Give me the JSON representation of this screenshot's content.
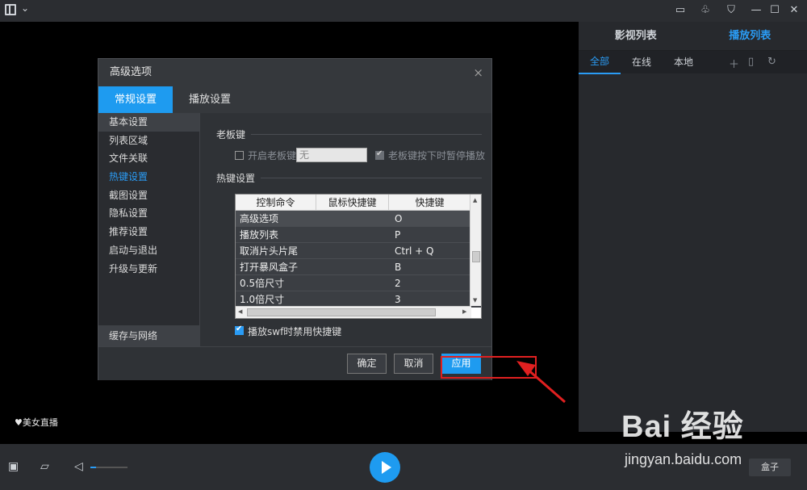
{
  "app": {
    "menu_chevron": "⌄",
    "top_icons": [
      "comment-icon",
      "bell-icon",
      "shirt-icon",
      "minimize-icon",
      "maximize-icon",
      "close-icon"
    ]
  },
  "right_panel": {
    "tabs": [
      {
        "label": "影视列表"
      },
      {
        "label": "播放列表"
      }
    ],
    "subtabs": [
      {
        "label": "全部"
      },
      {
        "label": "在线"
      },
      {
        "label": "本地"
      }
    ],
    "icons": [
      "add-icon",
      "add-file-icon",
      "refresh-icon"
    ]
  },
  "live_label": "美女直播",
  "bottom": {
    "box_label": "盒子",
    "volume_level": 0.15
  },
  "watermark": {
    "brand": "Bai 经验",
    "url": "jingyan.baidu.com"
  },
  "dialog": {
    "title": "高级选项",
    "close": "×",
    "tabs": [
      {
        "label": "常规设置"
      },
      {
        "label": "播放设置"
      }
    ],
    "sidebar": [
      {
        "label": "基本设置"
      },
      {
        "label": "列表区域"
      },
      {
        "label": "文件关联"
      },
      {
        "label": "热键设置"
      },
      {
        "label": "截图设置"
      },
      {
        "label": "隐私设置"
      },
      {
        "label": "推荐设置"
      },
      {
        "label": "启动与退出"
      },
      {
        "label": "升级与更新"
      }
    ],
    "sidebar_bottom": "缓存与网络",
    "boss_key": {
      "section": "老板键",
      "enable_label": "开启老板键",
      "key_value": "无",
      "pause_label": "老板键按下时暂停播放"
    },
    "hotkeys": {
      "section": "热键设置",
      "columns": [
        "控制命令",
        "鼠标快捷键",
        "快捷键"
      ],
      "rows": [
        {
          "command": "高级选项",
          "mouse": "",
          "key": "O"
        },
        {
          "command": "播放列表",
          "mouse": "",
          "key": "P"
        },
        {
          "command": "取消片头片尾",
          "mouse": "",
          "key": "Ctrl + Q"
        },
        {
          "command": "打开暴风盒子",
          "mouse": "",
          "key": "B"
        },
        {
          "command": "0.5倍尺寸",
          "mouse": "",
          "key": "2"
        },
        {
          "command": "1.0倍尺寸",
          "mouse": "",
          "key": "3"
        }
      ],
      "swf_label": "播放swf时禁用快捷键"
    },
    "buttons": {
      "ok": "确定",
      "cancel": "取消",
      "apply": "应用"
    }
  }
}
